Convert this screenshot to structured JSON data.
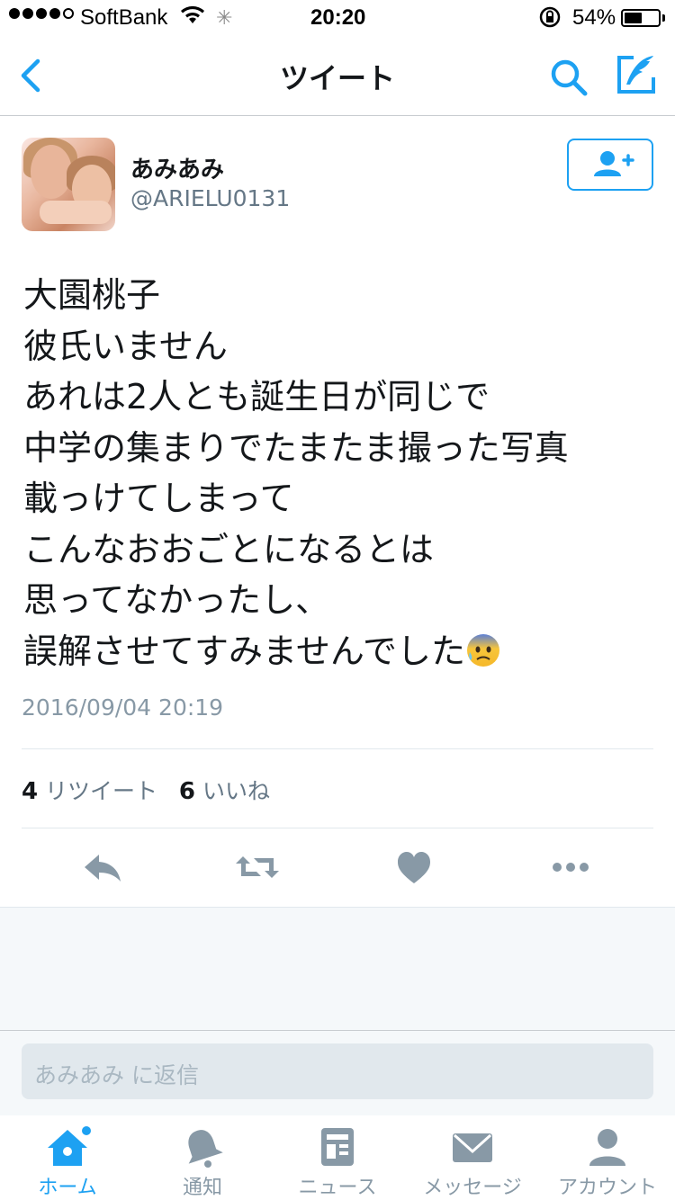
{
  "status_bar": {
    "carrier": "SoftBank",
    "time": "20:20",
    "battery_percent": "54%",
    "battery_level": 0.54,
    "signal_bars_filled": 4,
    "signal_bars_total": 5
  },
  "nav": {
    "title": "ツイート",
    "back_icon": "chevron-left-icon",
    "search_icon": "search-icon",
    "compose_icon": "compose-icon"
  },
  "tweet": {
    "display_name": "あみあみ",
    "handle": "@ARIELU0131",
    "text": "大園桃子\n彼氏いません\nあれは2人とも誕生日が同じで\n中学の集まりでたまたま撮った写真\n載っけてしまって\nこんなおおごとになるとは\n思ってなかったし、\n誤解させてすみませんでした",
    "trailing_emoji": "anxious-face-with-sweat",
    "timestamp": "2016/09/04 20:19",
    "retweet_count": "4",
    "retweet_label": "リツイート",
    "like_count": "6",
    "like_label": "いいね"
  },
  "reply": {
    "placeholder": "あみあみ に返信"
  },
  "tabbar": {
    "items": [
      {
        "label": "ホーム",
        "icon": "home-icon",
        "active": true
      },
      {
        "label": "通知",
        "icon": "bell-icon",
        "active": false
      },
      {
        "label": "ニュース",
        "icon": "news-icon",
        "active": false
      },
      {
        "label": "メッセージ",
        "icon": "envelope-icon",
        "active": false
      },
      {
        "label": "アカウント",
        "icon": "person-icon",
        "active": false
      }
    ]
  },
  "colors": {
    "accent": "#1da1f2",
    "muted": "#8899a6",
    "text": "#14171a"
  }
}
